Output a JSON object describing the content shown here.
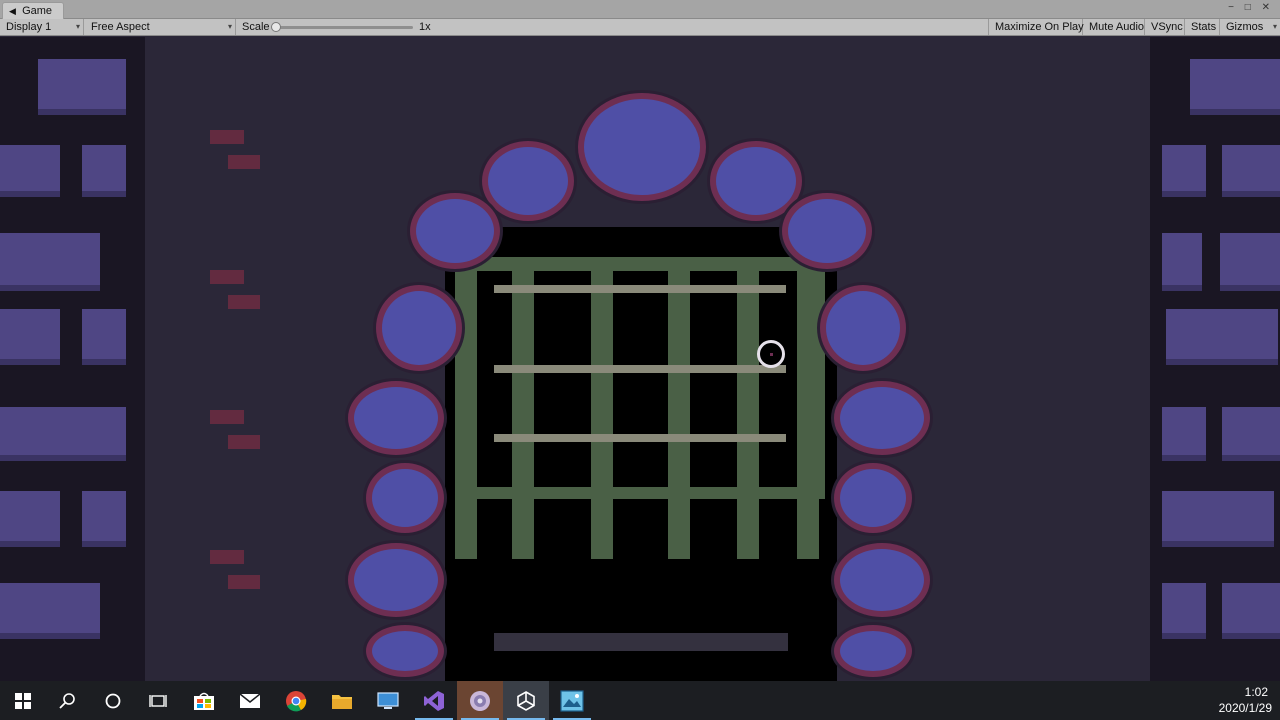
{
  "window": {
    "tab_title": "Game",
    "controls": [
      "−",
      "□",
      "✕"
    ]
  },
  "toolbar": {
    "display": "Display 1",
    "aspect": "Free Aspect",
    "scale_label": "Scale",
    "scale_value": "1x",
    "maximize_on_play": "Maximize On Play",
    "mute_audio": "Mute Audio",
    "vsync": "VSync",
    "stats": "Stats",
    "gizmos": "Gizmos"
  },
  "taskbar": {
    "icons": [
      "windows-start-icon",
      "search-icon",
      "cortana-icon",
      "task-view-icon",
      "store-icon",
      "mail-icon",
      "chrome-icon",
      "file-explorer-icon",
      "remote-desktop-icon",
      "visual-studio-icon",
      "app-icon",
      "unity-icon",
      "image-viewer-icon"
    ],
    "time": "1:02",
    "date": "2020/1/29"
  },
  "colors": {
    "game_bg": "#2b2738",
    "stone_fill": "#4f4fa6",
    "stone_rim": "#6e2e52",
    "grate": "#4a6046",
    "taskbar": "#1c1e22"
  }
}
